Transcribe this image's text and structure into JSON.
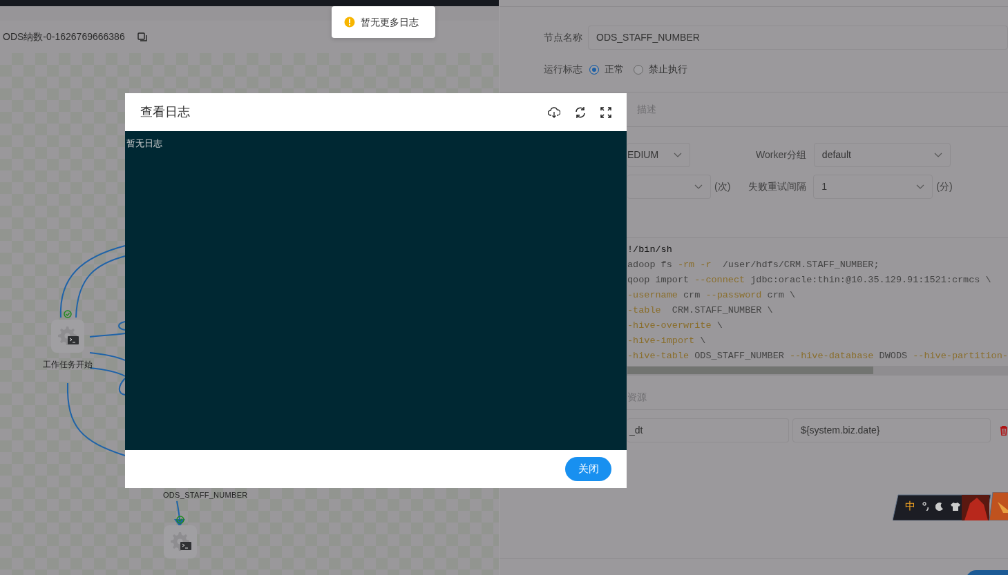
{
  "toast": {
    "kind": "warning",
    "text": "暂无更多日志"
  },
  "canvas": {
    "title": "ODS纳数-0-1626769666386",
    "nodes": [
      {
        "label": "工作任务开始",
        "success": true
      },
      {
        "success": true
      }
    ],
    "extra_labels": [
      "ODS_STAFF_NUMBER"
    ]
  },
  "dialog": {
    "title": "查看日志",
    "log": "暂无日志",
    "buttons": [
      {
        "label": "关闭"
      }
    ]
  },
  "form": {
    "node_name_label": "节点名称",
    "node_name": "ODS_STAFF_NUMBER",
    "run_flag_label": "运行标志",
    "run_flag_options": [
      {
        "label": "正常",
        "selected": true
      },
      {
        "label": "禁止执行",
        "selected": false
      }
    ],
    "description_placeholder": "描述",
    "priority": "EDIUM",
    "worker_group_label": "Worker分组",
    "worker_group": "default",
    "retry_times_unit": "(次)",
    "retry_interval_label": "失败重试间隔",
    "retry_interval": "1",
    "retry_interval_unit": "(分)",
    "script_lines": [
      [
        {
          "kind": "head",
          "text": "!/bin/sh"
        }
      ],
      [
        {
          "kind": "plain",
          "text": "adoop fs "
        },
        {
          "kind": "option",
          "text": "-rm -r"
        },
        {
          "kind": "plain",
          "text": "  /user/hdfs/CRM.STAFF_NUMBER;"
        }
      ],
      [
        {
          "kind": "plain",
          "text": "qoop import "
        },
        {
          "kind": "option",
          "text": "--connect"
        },
        {
          "kind": "plain",
          "text": " jdbc:oracle:thin:@10.35.129.91:1521:crmcs \\"
        }
      ],
      [
        {
          "kind": "option",
          "text": "-username"
        },
        {
          "kind": "plain",
          "text": " crm "
        },
        {
          "kind": "option",
          "text": "--password"
        },
        {
          "kind": "plain",
          "text": " crm \\"
        }
      ],
      [
        {
          "kind": "option",
          "text": "-table"
        },
        {
          "kind": "plain",
          "text": "  CRM.STAFF_NUMBER \\"
        }
      ],
      [
        {
          "kind": "option",
          "text": "-hive-overwrite"
        },
        {
          "kind": "plain",
          "text": " \\"
        }
      ],
      [
        {
          "kind": "option",
          "text": "-hive-import"
        },
        {
          "kind": "plain",
          "text": " \\"
        }
      ],
      [
        {
          "kind": "option",
          "text": "-hive-table"
        },
        {
          "kind": "plain",
          "text": " ODS_STAFF_NUMBER "
        },
        {
          "kind": "option",
          "text": "--hive-database"
        },
        {
          "kind": "plain",
          "text": " DWODS "
        },
        {
          "kind": "option",
          "text": "--hive-partition-"
        }
      ]
    ],
    "resource_placeholder": "资源",
    "params": [
      {
        "prop": "_dt",
        "value": "${system.biz.date}"
      }
    ]
  },
  "ime": {
    "mode": "中"
  }
}
